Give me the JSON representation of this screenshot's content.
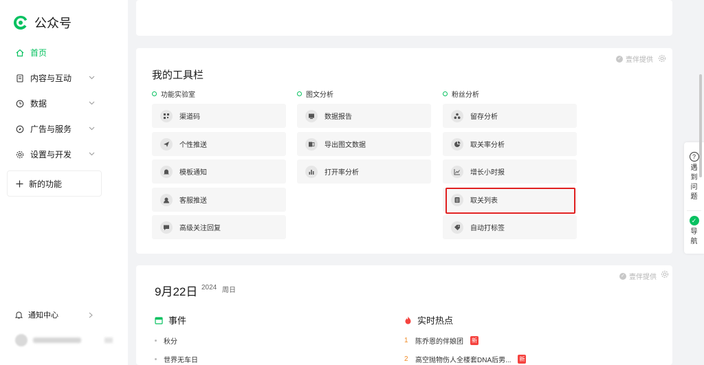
{
  "brand": {
    "name": "公众号"
  },
  "sidebar": {
    "items": [
      {
        "label": "首页",
        "icon": "home-icon",
        "active": true
      },
      {
        "label": "内容与互动",
        "icon": "document-icon"
      },
      {
        "label": "数据",
        "icon": "clock-icon"
      },
      {
        "label": "广告与服务",
        "icon": "compass-icon"
      },
      {
        "label": "设置与开发",
        "icon": "gear-icon"
      }
    ],
    "new_function": "新的功能",
    "notice_center": "通知中心"
  },
  "provider_label": "壹伴提供",
  "toolbar": {
    "title": "我的工具栏",
    "columns": [
      {
        "heading": "功能实验室",
        "tools": [
          "渠道码",
          "个性推送",
          "模板通知",
          "客服推送",
          "高级关注回复"
        ]
      },
      {
        "heading": "图文分析",
        "tools": [
          "数据报告",
          "导出图文数据",
          "打开率分析"
        ]
      },
      {
        "heading": "粉丝分析",
        "tools": [
          "留存分析",
          "取关率分析",
          "增长小时报",
          "取关列表",
          "自动打标签"
        ]
      }
    ]
  },
  "date_card": {
    "date": "9月22日",
    "year": "2024",
    "weekday": "周日",
    "events_title": "事件",
    "events": [
      "秋分",
      "世界无车日"
    ],
    "hot_title": "实时热点",
    "hot": [
      {
        "rank": "1",
        "text": "陈乔恩的伴娘团",
        "badge": "新"
      },
      {
        "rank": "2",
        "text": "高空抛物伤人全楼套DNA后男...",
        "badge": "新"
      }
    ]
  },
  "float_panel": {
    "help_label": [
      "遇",
      "到",
      "问",
      "题"
    ],
    "nav_label": [
      "导",
      "航"
    ]
  },
  "colors": {
    "accent": "#07c160",
    "highlight": "#e02020",
    "hot_rank": "#f08a24",
    "badge": "#f5433f"
  }
}
